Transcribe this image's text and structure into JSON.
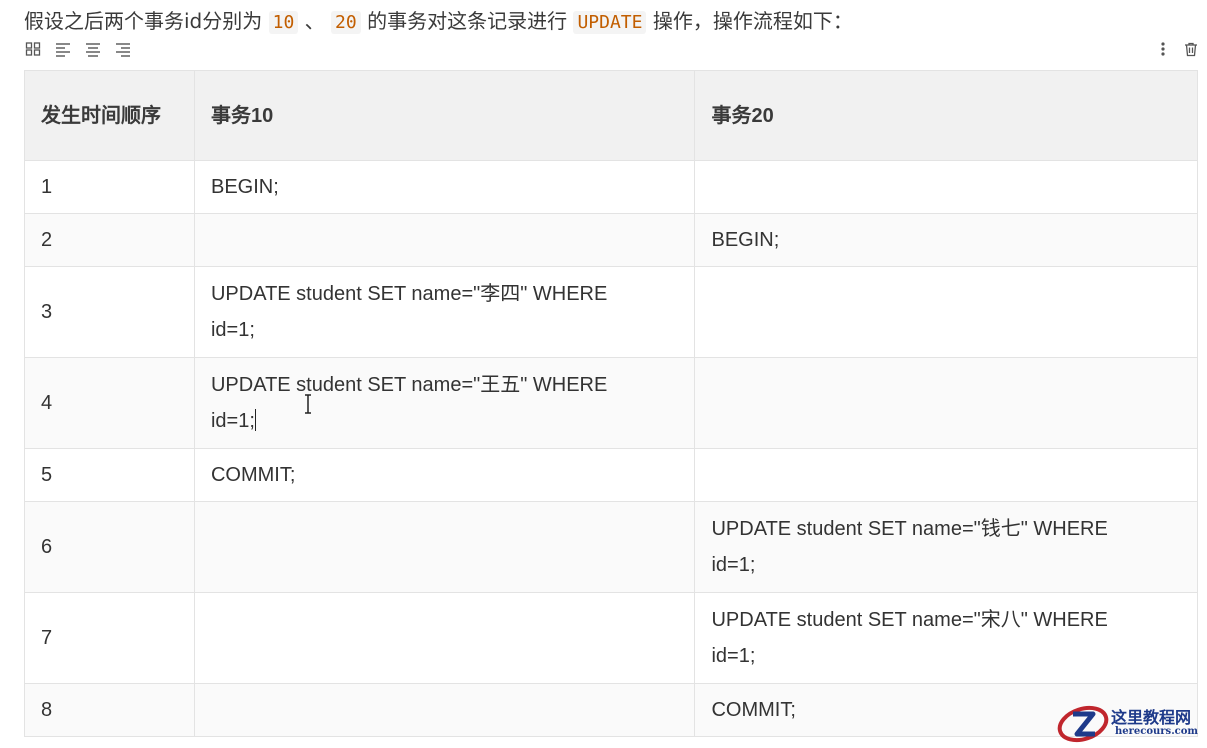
{
  "intro": {
    "before": "假设之后两个事务id分别为",
    "code1": "10",
    "sep": "、",
    "code2": "20",
    "middle": "的事务对这条记录进行",
    "code3": "UPDATE",
    "after": "操作，操作流程如下："
  },
  "toolbar": {
    "left_icons": [
      "grid-icon",
      "align-left-icon",
      "align-center-icon",
      "align-right-icon"
    ],
    "right_icons": [
      "more-vertical-icon",
      "trash-icon"
    ]
  },
  "table": {
    "headers": [
      "发生时间顺序",
      "事务10",
      "事务20"
    ],
    "rows": [
      {
        "seq": "1",
        "t10_a": "BEGIN;",
        "t10_b": "",
        "t20_a": "",
        "t20_b": ""
      },
      {
        "seq": "2",
        "t10_a": "",
        "t10_b": "",
        "t20_a": "BEGIN;",
        "t20_b": ""
      },
      {
        "seq": "3",
        "t10_a": "UPDATE student SET name=\"李四\" WHERE",
        "t10_b": "id=1;",
        "t20_a": "",
        "t20_b": ""
      },
      {
        "seq": "4",
        "t10_a": "UPDATE student SET name=\"王五\" WHERE",
        "t10_b": "id=1;",
        "t20_a": "",
        "t20_b": ""
      },
      {
        "seq": "5",
        "t10_a": "COMMIT;",
        "t10_b": "",
        "t20_a": "",
        "t20_b": ""
      },
      {
        "seq": "6",
        "t10_a": "",
        "t10_b": "",
        "t20_a": "UPDATE student SET name=\"钱七\" WHERE",
        "t20_b": "id=1;"
      },
      {
        "seq": "7",
        "t10_a": "",
        "t10_b": "",
        "t20_a": "UPDATE student SET name=\"宋八\" WHERE",
        "t20_b": "id=1;"
      },
      {
        "seq": "8",
        "t10_a": "",
        "t10_b": "",
        "t20_a": "COMMIT;",
        "t20_b": ""
      }
    ]
  },
  "watermark": {
    "title": "这里教程网",
    "subtitle": "herecours.com"
  },
  "colors": {
    "code_text": "#c25e00",
    "header_bg": "#f1f1f1",
    "border": "#e3e3e3",
    "watermark_blue": "#1e3a8a",
    "watermark_red": "#c0262d"
  }
}
